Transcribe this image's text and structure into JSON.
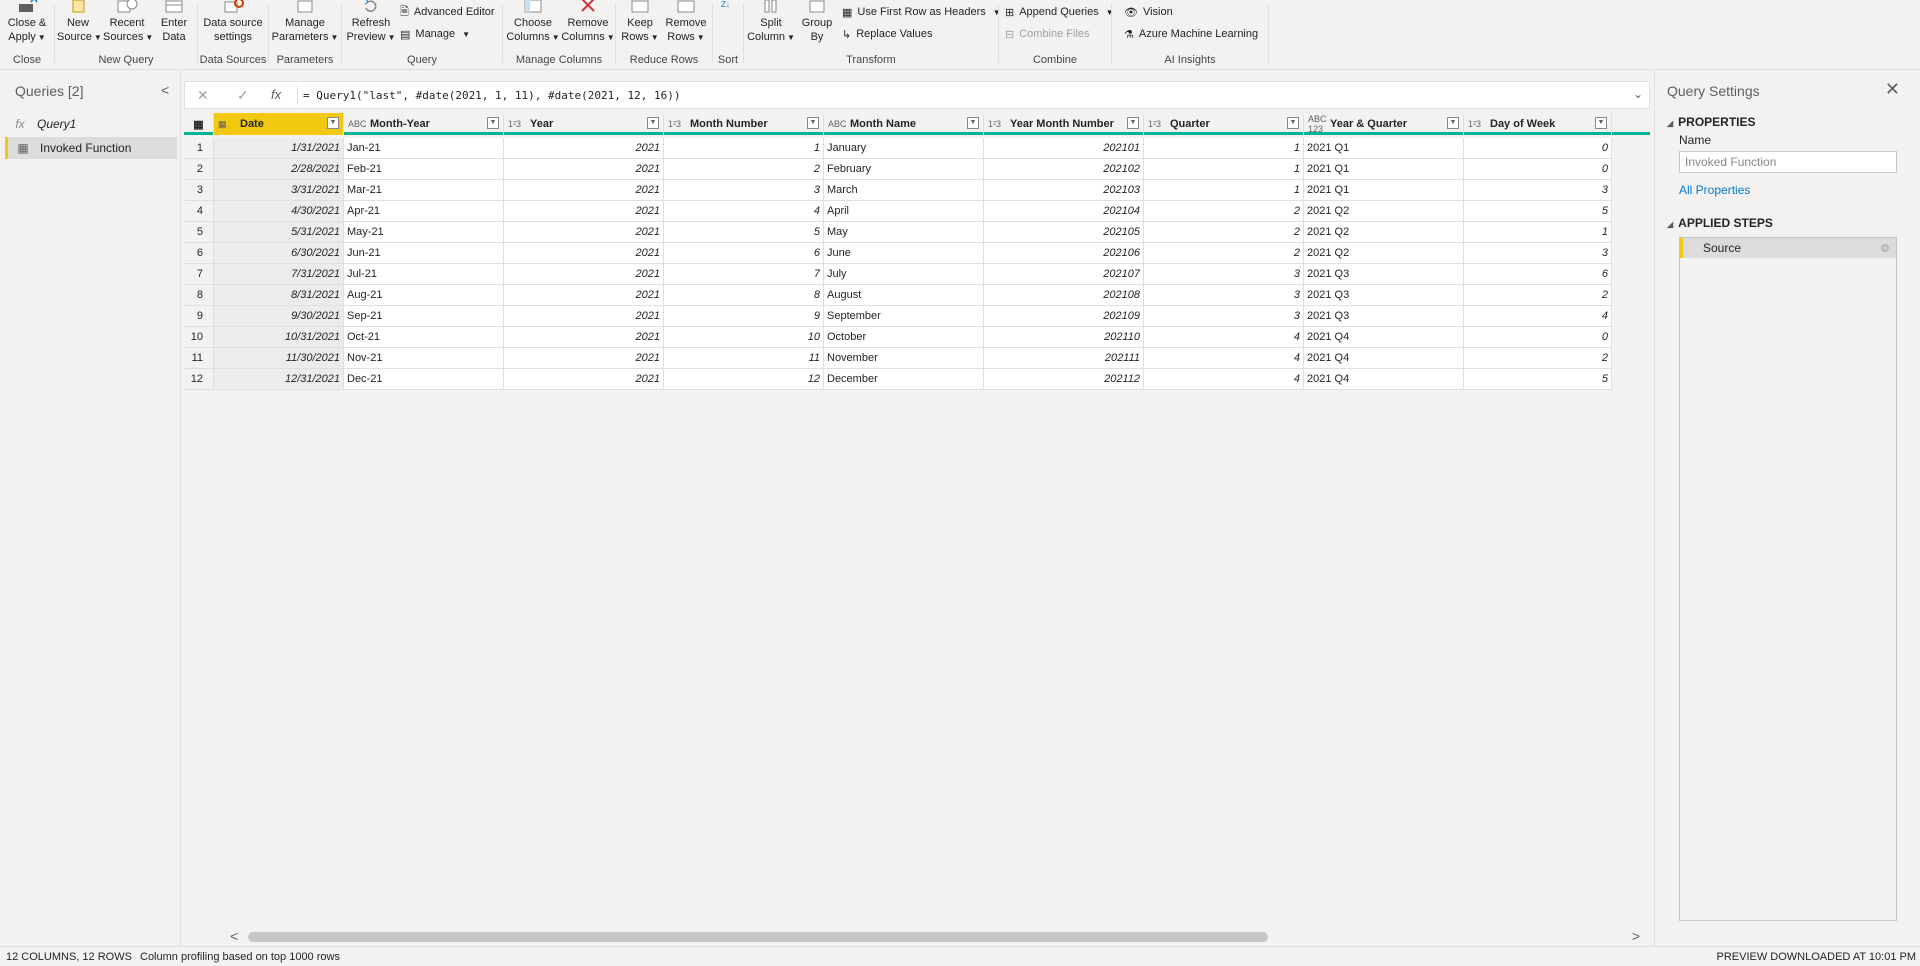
{
  "ribbon": {
    "groups": {
      "close": "Close",
      "new_query": "New Query",
      "data_sources": "Data Sources",
      "parameters": "Parameters",
      "query": "Query",
      "manage_columns": "Manage Columns",
      "reduce_rows": "Reduce Rows",
      "sort": "Sort",
      "transform": "Transform",
      "combine": "Combine",
      "ai_insights": "AI Insights"
    },
    "buttons": {
      "close_apply_1": "Close &",
      "close_apply_2": "Apply",
      "new_source_1": "New",
      "new_source_2": "Source",
      "recent_sources_1": "Recent",
      "recent_sources_2": "Sources",
      "enter_data_1": "Enter",
      "enter_data_2": "Data",
      "ds_settings_1": "Data source",
      "ds_settings_2": "settings",
      "manage_params_1": "Manage",
      "manage_params_2": "Parameters",
      "refresh_1": "Refresh",
      "refresh_2": "Preview",
      "advanced_editor": "Advanced Editor",
      "manage": "Manage",
      "choose_cols_1": "Choose",
      "choose_cols_2": "Columns",
      "remove_cols_1": "Remove",
      "remove_cols_2": "Columns",
      "keep_rows_1": "Keep",
      "keep_rows_2": "Rows",
      "remove_rows_1": "Remove",
      "remove_rows_2": "Rows",
      "split_col_1": "Split",
      "split_col_2": "Column",
      "group_by_1": "Group",
      "group_by_2": "By",
      "first_row_headers": "Use First Row as Headers",
      "replace_values": "Replace Values",
      "append_queries": "Append Queries",
      "combine_files": "Combine Files",
      "vision": "Vision",
      "azure_ml": "Azure Machine Learning"
    }
  },
  "queries": {
    "title": "Queries [2]",
    "items": [
      {
        "label": "Query1",
        "icon": "fx"
      },
      {
        "label": "Invoked Function",
        "icon": "table"
      }
    ]
  },
  "formula": {
    "fx": "fx",
    "text": "= Query1(\"last\", #date(2021, 1, 11), #date(2021, 12, 16))"
  },
  "columns": [
    {
      "name": "Date",
      "type": "date"
    },
    {
      "name": "Month-Year",
      "type": "ABC"
    },
    {
      "name": "Year",
      "type": "123"
    },
    {
      "name": "Month Number",
      "type": "123"
    },
    {
      "name": "Month Name",
      "type": "ABC"
    },
    {
      "name": "Year Month Number",
      "type": "123"
    },
    {
      "name": "Quarter",
      "type": "123"
    },
    {
      "name": "Year & Quarter",
      "type": "ABC123"
    },
    {
      "name": "Day of Week",
      "type": "123"
    }
  ],
  "rows": [
    [
      "1",
      "1/31/2021",
      "Jan-21",
      "2021",
      "1",
      "January",
      "202101",
      "1",
      "2021 Q1",
      "0"
    ],
    [
      "2",
      "2/28/2021",
      "Feb-21",
      "2021",
      "2",
      "February",
      "202102",
      "1",
      "2021 Q1",
      "0"
    ],
    [
      "3",
      "3/31/2021",
      "Mar-21",
      "2021",
      "3",
      "March",
      "202103",
      "1",
      "2021 Q1",
      "3"
    ],
    [
      "4",
      "4/30/2021",
      "Apr-21",
      "2021",
      "4",
      "April",
      "202104",
      "2",
      "2021 Q2",
      "5"
    ],
    [
      "5",
      "5/31/2021",
      "May-21",
      "2021",
      "5",
      "May",
      "202105",
      "2",
      "2021 Q2",
      "1"
    ],
    [
      "6",
      "6/30/2021",
      "Jun-21",
      "2021",
      "6",
      "June",
      "202106",
      "2",
      "2021 Q2",
      "3"
    ],
    [
      "7",
      "7/31/2021",
      "Jul-21",
      "2021",
      "7",
      "July",
      "202107",
      "3",
      "2021 Q3",
      "6"
    ],
    [
      "8",
      "8/31/2021",
      "Aug-21",
      "2021",
      "8",
      "August",
      "202108",
      "3",
      "2021 Q3",
      "2"
    ],
    [
      "9",
      "9/30/2021",
      "Sep-21",
      "2021",
      "9",
      "September",
      "202109",
      "3",
      "2021 Q3",
      "4"
    ],
    [
      "10",
      "10/31/2021",
      "Oct-21",
      "2021",
      "10",
      "October",
      "202110",
      "4",
      "2021 Q4",
      "0"
    ],
    [
      "11",
      "11/30/2021",
      "Nov-21",
      "2021",
      "11",
      "November",
      "202111",
      "4",
      "2021 Q4",
      "2"
    ],
    [
      "12",
      "12/31/2021",
      "Dec-21",
      "2021",
      "12",
      "December",
      "202112",
      "4",
      "2021 Q4",
      "5"
    ]
  ],
  "settings": {
    "title": "Query Settings",
    "properties": "PROPERTIES",
    "name_label": "Name",
    "name_value": "Invoked Function",
    "all_properties": "All Properties",
    "applied_steps": "APPLIED STEPS",
    "steps": [
      "Source"
    ]
  },
  "status": {
    "summary": "12 COLUMNS, 12 ROWS",
    "profiling": "Column profiling based on top 1000 rows",
    "preview": "PREVIEW DOWNLOADED AT 10:01 PM"
  },
  "colors": {
    "accent_yellow": "#f2c811",
    "accent_teal": "#00b294",
    "link_blue": "#0078d4"
  }
}
